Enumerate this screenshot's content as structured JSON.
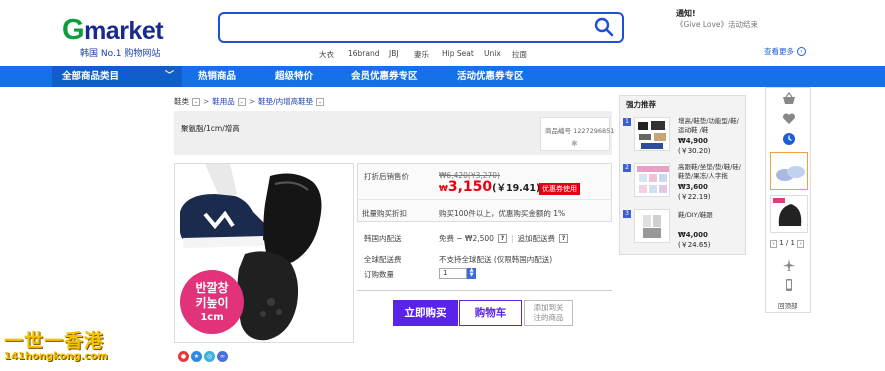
{
  "header": {
    "logo_g": "G",
    "logo_rest": "market",
    "logo_sub": "韩国 No.1 购物网站",
    "search_placeholder": "",
    "keywords": [
      "大衣",
      "16brand",
      "JBJ",
      "妻乐",
      "Hip Seat",
      "Unix",
      "拉面"
    ],
    "notice_title": "通知!",
    "notice_text": "《Give Love》活动结束",
    "more_label": "查看更多"
  },
  "nav": {
    "category_label": "全部商品类目",
    "items": [
      "热销商品",
      "超级特价",
      "会员优惠券专区",
      "活动优惠券专区"
    ]
  },
  "breadcrumb": [
    "鞋类",
    "鞋用品",
    "鞋垫/内增高鞋垫"
  ],
  "product": {
    "title": "聚氨脂/1cm/增高",
    "code_label": "商品编号 1227296851",
    "badge_line1": "반깔창",
    "badge_line2": "키높이",
    "badge_line3": "1cm"
  },
  "price": {
    "sale_label": "打折后销售价",
    "original": "₩6,420(¥3,270)",
    "currency": "₩",
    "sale": "3,150",
    "rmb": "(￥19.41)",
    "coupon": "优惠券使用",
    "bulk_label": "批量购买折扣",
    "bulk_text": "购买100件以上，优惠购买金额的 1%"
  },
  "shipping": {
    "domestic_label": "韩国内配送",
    "domestic_value": "免费 ~ ₩2,500",
    "extra_label": "追加配送费",
    "global_label": "全球配送费",
    "global_value": "不支持全球配送 (仅限韩国内配送)",
    "qty_label": "订购数量",
    "qty_value": "1"
  },
  "buttons": {
    "buy": "立即购买",
    "cart": "购物车",
    "watch_line1": "添加到关",
    "watch_line2": "注的商品"
  },
  "watermark": {
    "line1": "一世一香港",
    "line2": "141hongkong.com"
  },
  "recommend": {
    "title": "强力推荐",
    "items": [
      {
        "num": "1",
        "name": "增高/鞋垫/功能型/鞋/运动鞋 /鞋",
        "price": "₩4,900",
        "rmb": "(￥30.20)"
      },
      {
        "num": "2",
        "name": "高跟鞋/坐垫/垫/鞋/硅/鞋垫/果冻/人字拖",
        "price": "₩3,600",
        "rmb": "(￥22.19)"
      },
      {
        "num": "3",
        "name": "鞋/DIY/鞋跟",
        "price": "₩4,000",
        "rmb": "(￥24.65)"
      }
    ]
  },
  "rail": {
    "pager": "1 / 1",
    "top_label": "回顶部"
  },
  "colors": {
    "nav_blue": "#1671e8",
    "buy_purple": "#5a24e8",
    "sale_red": "#e60012"
  }
}
